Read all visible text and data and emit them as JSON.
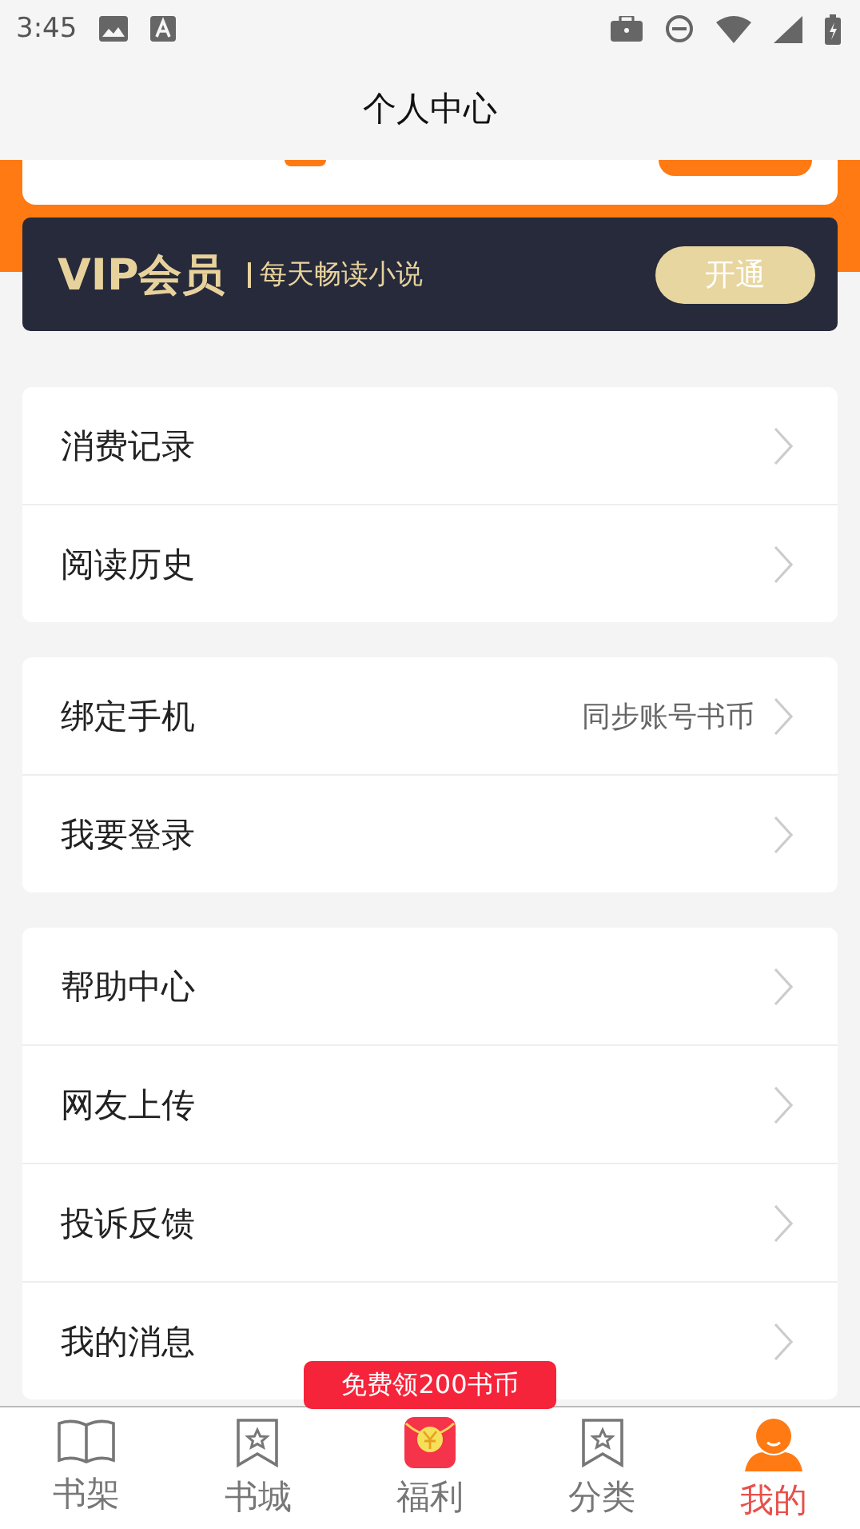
{
  "status_bar": {
    "time": "3:45"
  },
  "header": {
    "title": "个人中心"
  },
  "vip_banner": {
    "title": "VIP会员",
    "subtitle": "每天畅读小说",
    "button": "开通"
  },
  "groups": [
    {
      "items": [
        {
          "label": "消费记录"
        },
        {
          "label": "阅读历史"
        }
      ]
    },
    {
      "items": [
        {
          "label": "绑定手机",
          "hint": "同步账号书币"
        },
        {
          "label": "我要登录"
        }
      ]
    },
    {
      "items": [
        {
          "label": "帮助中心"
        },
        {
          "label": "网友上传"
        },
        {
          "label": "投诉反馈"
        },
        {
          "label": "我的消息"
        }
      ]
    }
  ],
  "promo_badge": "免费领200书币",
  "tabs": [
    {
      "label": "书架",
      "kind": "book",
      "selected": false
    },
    {
      "label": "书城",
      "kind": "bookmark",
      "selected": false
    },
    {
      "label": "福利",
      "kind": "redpacket",
      "selected": false
    },
    {
      "label": "分类",
      "kind": "bookmark",
      "selected": false
    },
    {
      "label": "我的",
      "kind": "person",
      "selected": true
    }
  ]
}
